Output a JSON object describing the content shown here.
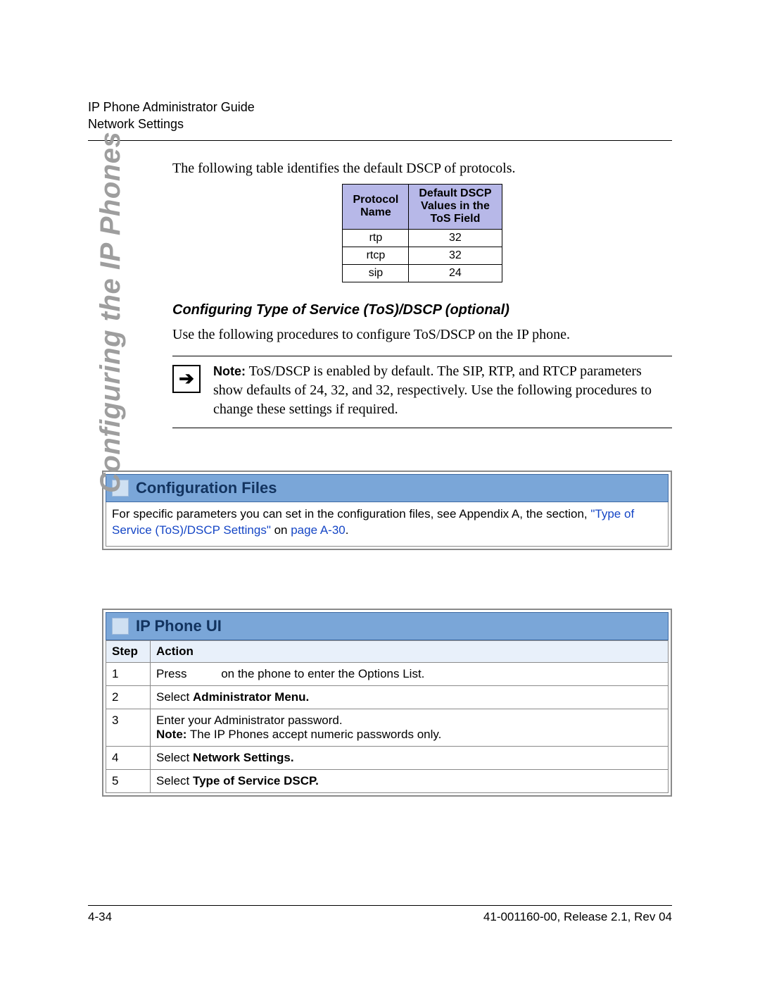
{
  "header": {
    "line1": "IP Phone Administrator Guide",
    "line2": "Network Settings"
  },
  "side_label": "Configuring the IP Phones",
  "intro": "The following table identifies the default DSCP of protocols.",
  "dscp_table": {
    "headers": [
      "Protocol Name",
      "Default DSCP Values in the ToS Field"
    ],
    "rows": [
      {
        "name": "rtp",
        "value": "32"
      },
      {
        "name": "rtcp",
        "value": "32"
      },
      {
        "name": "sip",
        "value": "24"
      }
    ]
  },
  "subheading": "Configuring Type of Service (ToS)/DSCP (optional)",
  "body1": "Use the following procedures to configure ToS/DSCP on the IP phone.",
  "note": {
    "label": "Note:",
    "text": " ToS/DSCP is enabled by default. The SIP, RTP, and RTCP parameters show defaults of 24, 32, and 32, respectively. Use the following procedures to change these settings if required."
  },
  "config_panel": {
    "title": "Configuration Files",
    "body_pre": "For specific parameters you can set in the configuration files, see Appendix A, the section, ",
    "link1": "\"Type of Service (ToS)/DSCP Settings\"",
    "body_mid": " on ",
    "link2": "page A-30",
    "body_post": "."
  },
  "ui_panel": {
    "title": "IP Phone UI",
    "headers": [
      "Step",
      "Action"
    ],
    "steps": [
      {
        "n": "1",
        "pre": "Press",
        "post": " on the phone to enter the Options List."
      },
      {
        "n": "2",
        "pre": "Select ",
        "bold": "Administrator Menu."
      },
      {
        "n": "3",
        "line1": "Enter your Administrator password.",
        "note_label": "Note:",
        "note_text": " The IP Phones accept numeric passwords only."
      },
      {
        "n": "4",
        "pre": "Select ",
        "bold": "Network Settings."
      },
      {
        "n": "5",
        "pre": "Select ",
        "bold": "Type of Service DSCP."
      }
    ]
  },
  "footer": {
    "left": "4-34",
    "right": "41-001160-00, Release 2.1, Rev 04"
  }
}
